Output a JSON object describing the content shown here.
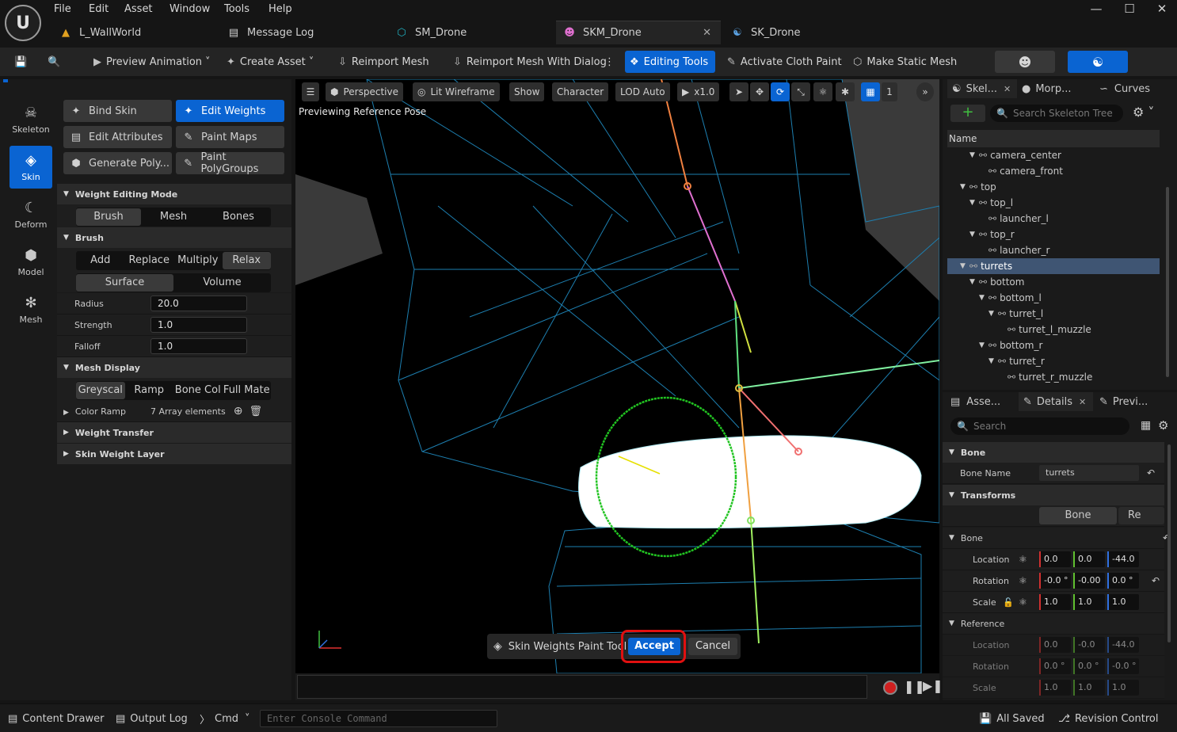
{
  "menu": [
    "File",
    "Edit",
    "Asset",
    "Window",
    "Tools",
    "Help"
  ],
  "tabs": [
    {
      "label": "L_WallWorld",
      "icon": "level-icon"
    },
    {
      "label": "Message Log",
      "icon": "log-icon"
    },
    {
      "label": "SM_Drone",
      "icon": "static-mesh-icon"
    },
    {
      "label": "SKM_Drone",
      "icon": "skeletal-mesh-icon",
      "active": true
    },
    {
      "label": "SK_Drone",
      "icon": "skeleton-icon"
    }
  ],
  "toolbar": {
    "preview_animation": "Preview Animation",
    "create_asset": "Create Asset",
    "reimport_mesh": "Reimport Mesh",
    "reimport_dialog": "Reimport Mesh With Dialog",
    "editing_tools": "Editing Tools",
    "cloth_paint": "Activate Cloth Paint",
    "make_static": "Make Static Mesh"
  },
  "modes": [
    {
      "label": "Skeleton",
      "icon": "skeleton-icon"
    },
    {
      "label": "Skin",
      "icon": "skin-icon",
      "active": true
    },
    {
      "label": "Deform",
      "icon": "deform-icon"
    },
    {
      "label": "Model",
      "icon": "model-icon"
    },
    {
      "label": "Mesh",
      "icon": "mesh-icon"
    }
  ],
  "tools": {
    "bind_skin": "Bind Skin",
    "edit_weights": "Edit Weights",
    "edit_attributes": "Edit Attributes",
    "paint_maps": "Paint Maps",
    "generate_poly": "Generate Poly...",
    "paint_polygroups": "Paint PolyGroups"
  },
  "weight_editing_mode": {
    "title": "Weight Editing Mode",
    "options": [
      "Brush",
      "Mesh",
      "Bones"
    ],
    "selected": "Brush"
  },
  "brush": {
    "title": "Brush",
    "modes": [
      "Add",
      "Replace",
      "Multiply",
      "Relax"
    ],
    "selected_mode": "Relax",
    "falloff_types": [
      "Surface",
      "Volume"
    ],
    "selected_falloff": "Surface",
    "radius_label": "Radius",
    "radius": "20.0",
    "strength_label": "Strength",
    "strength": "1.0",
    "falloff_label": "Falloff",
    "falloff": "1.0"
  },
  "mesh_display": {
    "title": "Mesh Display",
    "options": [
      "Greyscal",
      "Ramp",
      "Bone Col",
      "Full Mate"
    ],
    "selected": "Greyscal",
    "color_ramp_label": "Color Ramp",
    "color_ramp_value": "7 Array elements"
  },
  "sections": {
    "weight_transfer": "Weight Transfer",
    "skin_weight_layer": "Skin Weight Layer"
  },
  "viewport": {
    "perspective": "Perspective",
    "lit_wireframe": "Lit Wireframe",
    "show": "Show",
    "character": "Character",
    "lod": "LOD Auto",
    "speed": "x1.0",
    "grid_count": "1",
    "preview_text": "Previewing Reference Pose",
    "tool_name": "Skin Weights Paint Tool",
    "accept": "Accept",
    "cancel": "Cancel"
  },
  "skeleton_panel": {
    "tabs": [
      "Skel...",
      "Morp...",
      "Curves"
    ],
    "search_placeholder": "Search Skeleton Tree",
    "column": "Name",
    "bones": [
      {
        "name": "camera_center",
        "depth": 2
      },
      {
        "name": "camera_front",
        "depth": 3
      },
      {
        "name": "top",
        "depth": 1
      },
      {
        "name": "top_l",
        "depth": 2
      },
      {
        "name": "launcher_l",
        "depth": 3
      },
      {
        "name": "top_r",
        "depth": 2
      },
      {
        "name": "launcher_r",
        "depth": 3
      },
      {
        "name": "turrets",
        "depth": 1,
        "selected": true
      },
      {
        "name": "bottom",
        "depth": 2
      },
      {
        "name": "bottom_l",
        "depth": 3
      },
      {
        "name": "turret_l",
        "depth": 4
      },
      {
        "name": "turret_l_muzzle",
        "depth": 5
      },
      {
        "name": "bottom_r",
        "depth": 3
      },
      {
        "name": "turret_r",
        "depth": 4
      },
      {
        "name": "turret_r_muzzle",
        "depth": 5
      }
    ]
  },
  "details_panel": {
    "tabs": [
      "Asse...",
      "Details",
      "Previ..."
    ],
    "search_placeholder": "Search",
    "bone_section": "Bone",
    "bone_name_label": "Bone Name",
    "bone_name": "turrets",
    "transforms_section": "Transforms",
    "bone_btn": "Bone",
    "re_btn": "Re",
    "bone_sub": "Bone",
    "location_label": "Location",
    "location": [
      "0.0",
      "0.0",
      "-44.0"
    ],
    "rotation_label": "Rotation",
    "rotation": [
      "-0.0 °",
      "-0.00",
      "0.0 °"
    ],
    "scale_label": "Scale",
    "scale": [
      "1.0",
      "1.0",
      "1.0"
    ],
    "reference_section": "Reference",
    "ref_location": [
      "0.0",
      "-0.0",
      "-44.0"
    ],
    "ref_rotation": [
      "0.0 °",
      "0.0 °",
      "-0.0 °"
    ],
    "ref_scale": [
      "1.0",
      "1.0",
      "1.0"
    ]
  },
  "statusbar": {
    "content_drawer": "Content Drawer",
    "output_log": "Output Log",
    "cmd": "Cmd",
    "console_placeholder": "Enter Console Command",
    "all_saved": "All Saved",
    "revision_control": "Revision Control"
  }
}
